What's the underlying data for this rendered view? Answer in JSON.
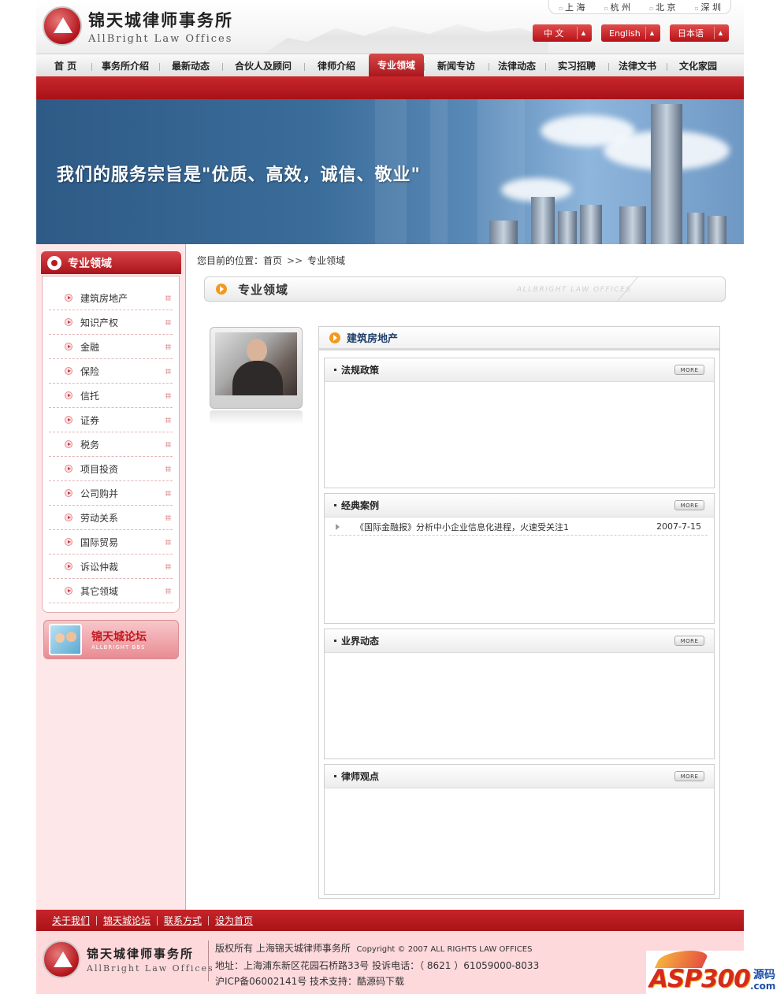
{
  "header": {
    "logo_cn": "锦天城律师事务所",
    "logo_en": "AllBright Law Offices",
    "cities": [
      "上 海",
      "杭 州",
      "北 京",
      "深 圳"
    ],
    "languages": [
      {
        "label": "中 文"
      },
      {
        "label": "English"
      },
      {
        "label": "日本语"
      }
    ]
  },
  "nav": {
    "items": [
      {
        "label": "首 页"
      },
      {
        "label": "事务所介绍"
      },
      {
        "label": "最新动态"
      },
      {
        "label": "合伙人及顾问"
      },
      {
        "label": "律师介绍"
      },
      {
        "label": "专业领域",
        "active": true
      },
      {
        "label": "新闻专访"
      },
      {
        "label": "法律动态"
      },
      {
        "label": "实习招聘"
      },
      {
        "label": "法律文书"
      },
      {
        "label": "文化家园"
      }
    ]
  },
  "banner": {
    "slogan": "我们的服务宗旨是\"优质、高效，诚信、敬业\""
  },
  "sidebar": {
    "title": "专业领域",
    "items": [
      {
        "label": "建筑房地产"
      },
      {
        "label": "知识产权"
      },
      {
        "label": "金融"
      },
      {
        "label": "保险"
      },
      {
        "label": "信托"
      },
      {
        "label": "证券"
      },
      {
        "label": "税务"
      },
      {
        "label": "项目投资"
      },
      {
        "label": "公司购并"
      },
      {
        "label": "劳动关系"
      },
      {
        "label": "国际贸易"
      },
      {
        "label": "诉讼仲裁"
      },
      {
        "label": "其它领域"
      }
    ],
    "forum_cn": "锦天城论坛",
    "forum_en": "ALLBRIGHT BBS"
  },
  "breadcrumb": {
    "prefix": "您目前的位置：",
    "home": "首页",
    "separator": ">>",
    "current": "专业领域"
  },
  "section": {
    "title": "专业领域",
    "watermark": "ALLBRIGHT LAW OFFICES"
  },
  "content": {
    "title": "建筑房地产",
    "more_label": "MORE",
    "panels": [
      {
        "title": "法规政策",
        "items": []
      },
      {
        "title": "经典案例",
        "items": [
          {
            "title": "《国际金融报》分析中小企业信息化进程，火速受关注1",
            "date": "2007-7-15"
          }
        ]
      },
      {
        "title": "业界动态",
        "items": []
      },
      {
        "title": "律师观点",
        "items": []
      }
    ]
  },
  "footer": {
    "links": [
      "关于我们",
      "锦天城论坛",
      "联系方式",
      "设为首页"
    ],
    "copyright": "版权所有  上海锦天城律师事务所",
    "copyright_en": "Copyright © 2007 ALL RIGHTS LAW OFFICES",
    "address": "地址：上海浦东新区花园石桥路33号  投诉电话：（ 8621 ）61059000-8033",
    "icp": "沪ICP备06002141号  技术支持：酷源码下载"
  },
  "badge": {
    "asp": "ASP300",
    "yuan": "源码",
    "com": ".com"
  }
}
